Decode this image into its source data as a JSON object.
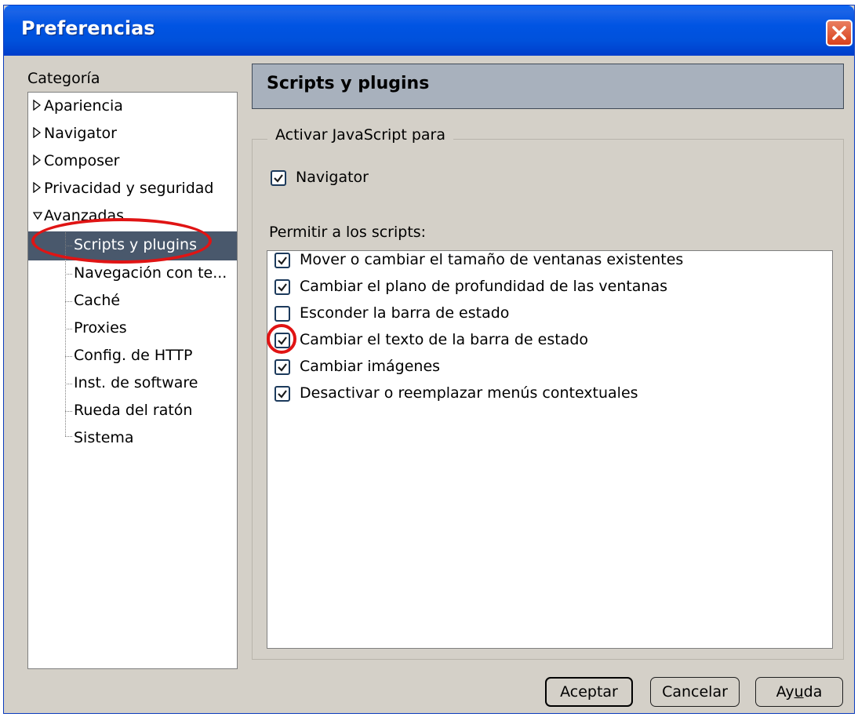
{
  "window": {
    "title": "Preferencias"
  },
  "sidebar": {
    "label": "Categoría",
    "items": [
      {
        "label": "Apariencia",
        "state": "collapsed"
      },
      {
        "label": "Navigator",
        "state": "collapsed"
      },
      {
        "label": "Composer",
        "state": "collapsed"
      },
      {
        "label": "Privacidad y seguridad",
        "state": "collapsed"
      },
      {
        "label": "Avanzadas",
        "state": "expanded"
      }
    ],
    "subitems": [
      {
        "label": "Scripts y plugins",
        "selected": true
      },
      {
        "label": "Navegación con te..."
      },
      {
        "label": "Caché"
      },
      {
        "label": "Proxies"
      },
      {
        "label": "Config. de HTTP"
      },
      {
        "label": "Inst. de software"
      },
      {
        "label": "Rueda del ratón"
      },
      {
        "label": "Sistema"
      }
    ]
  },
  "panel": {
    "title": "Scripts y plugins",
    "js_group_label": "Activar JavaScript para",
    "navigator": {
      "label": "Navigator",
      "checked": true
    },
    "permit_label": "Permitir a los scripts:",
    "permissions": [
      {
        "label": "Mover o cambiar el tamaño de ventanas existentes",
        "checked": true
      },
      {
        "label": "Cambiar el plano de profundidad de las ventanas",
        "checked": true
      },
      {
        "label": "Esconder la barra de estado",
        "checked": false
      },
      {
        "label": "Cambiar el texto de la barra de estado",
        "checked": true
      },
      {
        "label": "Cambiar imágenes",
        "checked": true
      },
      {
        "label": "Desactivar o reemplazar menús contextuales",
        "checked": true
      }
    ]
  },
  "buttons": {
    "ok": "Aceptar",
    "cancel": "Cancelar",
    "help_pre": "Ay",
    "help_mnemonic": "u",
    "help_post": "da"
  },
  "colors": {
    "title_bar": "#0054e3",
    "selection": "#49586c",
    "header_panel": "#a8b1bd",
    "annotation": "#e01414"
  }
}
